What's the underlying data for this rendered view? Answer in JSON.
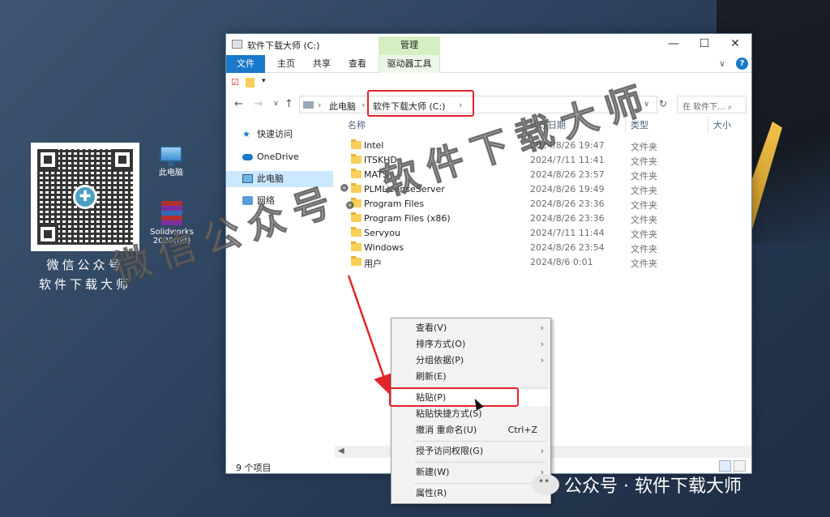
{
  "window": {
    "title": "软件下载大师 (C:)",
    "context_tab": "管理",
    "controls": {
      "minimize": "—",
      "maximize": "☐",
      "close": "✕"
    }
  },
  "ribbon": {
    "tabs": [
      "文件",
      "主页",
      "共享",
      "查看",
      "驱动器工具"
    ],
    "collapse": "∨",
    "help": "?"
  },
  "address": {
    "root": "此电脑",
    "current": "软件下载大师 (C:)",
    "sep": "›",
    "search_placeholder": "在 软件下... ⌕"
  },
  "nav_pane": {
    "items": [
      "快速访问",
      "OneDrive",
      "此电脑",
      "网络"
    ]
  },
  "columns": {
    "name": "名称",
    "date": "修改日期",
    "type": "类型",
    "size": "大小"
  },
  "files": [
    {
      "name": "Intel",
      "date": "2024/8/26 19:47",
      "type": "文件夹"
    },
    {
      "name": "ITSKHD",
      "date": "2024/7/11 11:41",
      "type": "文件夹"
    },
    {
      "name": "MATS",
      "date": "2024/8/26 23:57",
      "type": "文件夹"
    },
    {
      "name": "PLMLicenseServer",
      "date": "2024/8/26 19:49",
      "type": "文件夹"
    },
    {
      "name": "Program Files",
      "date": "2024/8/26 23:36",
      "type": "文件夹"
    },
    {
      "name": "Program Files (x86)",
      "date": "2024/8/26 23:36",
      "type": "文件夹"
    },
    {
      "name": "Servyou",
      "date": "2024/7/11 11:44",
      "type": "文件夹"
    },
    {
      "name": "Windows",
      "date": "2024/8/26 23:54",
      "type": "文件夹"
    },
    {
      "name": "用户",
      "date": "2024/8/6 0:01",
      "type": "文件夹"
    }
  ],
  "status": {
    "count": "9 个项目"
  },
  "context_menu": {
    "items": [
      {
        "label": "查看(V)",
        "submenu": "›"
      },
      {
        "label": "排序方式(O)",
        "submenu": "›"
      },
      {
        "label": "分组依据(P)",
        "submenu": "›"
      },
      {
        "label": "刷新(E)"
      },
      {
        "label": "粘贴(P)"
      },
      {
        "label": "粘贴快捷方式(S)"
      },
      {
        "label": "撤消 重命名(U)",
        "shortcut": "Ctrl+Z"
      },
      {
        "label": "授予访问权限(G)",
        "submenu": "›"
      },
      {
        "label": "新建(W)",
        "submenu": "›"
      },
      {
        "label": "属性(R)"
      }
    ]
  },
  "desktop": {
    "qr_caption_line1": "微信公众号",
    "qr_caption_line2": "软件下载大师",
    "icons": [
      {
        "label": "此电脑"
      },
      {
        "label": "Solidworks 2020(bit)"
      }
    ]
  },
  "watermarks": {
    "overlay": "微信公众号：软件下载大师",
    "bottom": "公众号 · 软件下载大师"
  },
  "colors": {
    "accent": "#1979ca",
    "highlight": "#e0242a",
    "manage_tab": "#d5eec4",
    "selection": "#cce8ff"
  }
}
